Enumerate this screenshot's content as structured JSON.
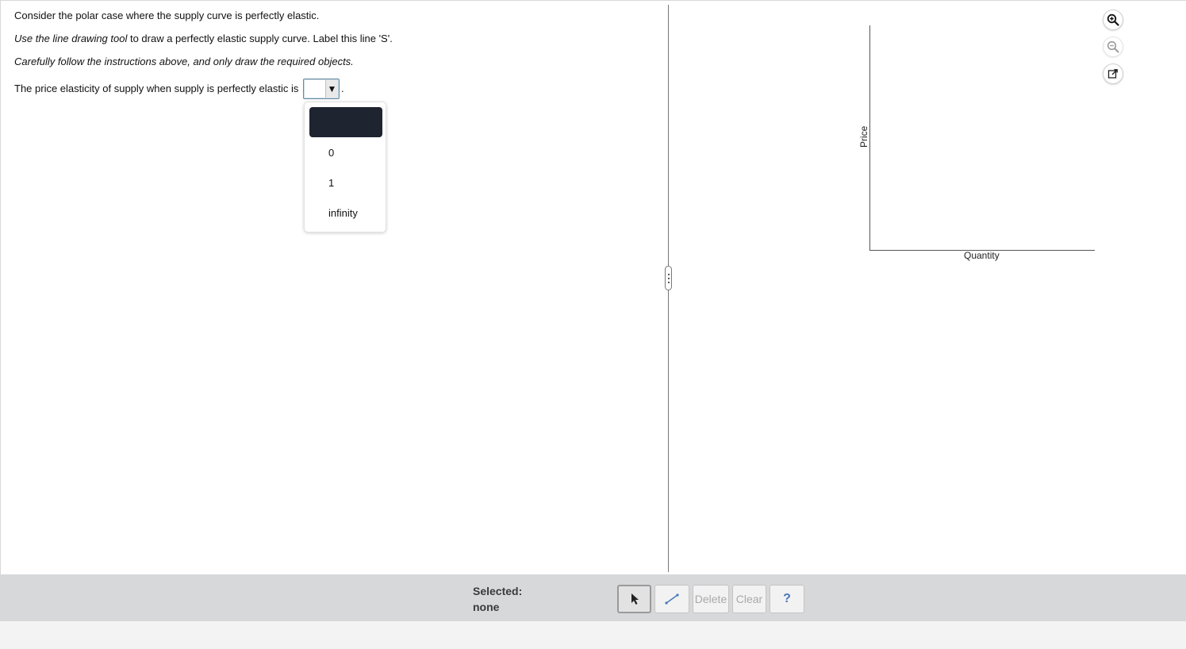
{
  "question": {
    "line1": "Consider the polar case where the supply curve is perfectly elastic.",
    "line2_italic": "Use the line drawing tool",
    "line2_rest": " to draw a perfectly elastic supply curve. Label this line 'S'.",
    "line3": "Carefully follow the instructions above, and only draw the required objects.",
    "line4": "The price elasticity of supply when supply is perfectly elastic is",
    "line4_end": ".",
    "dropdown": {
      "selected": "",
      "options": [
        "",
        "0",
        "1",
        "infinity"
      ]
    }
  },
  "graph": {
    "y_axis_label": "Price",
    "x_axis_label": "Quantity",
    "icons": [
      "zoom-in-icon",
      "zoom-out-icon",
      "popout-icon"
    ]
  },
  "toolbar": {
    "selected_label": "Selected:",
    "selected_value": "none",
    "delete_label": "Delete",
    "clear_label": "Clear",
    "help_label": "?"
  }
}
